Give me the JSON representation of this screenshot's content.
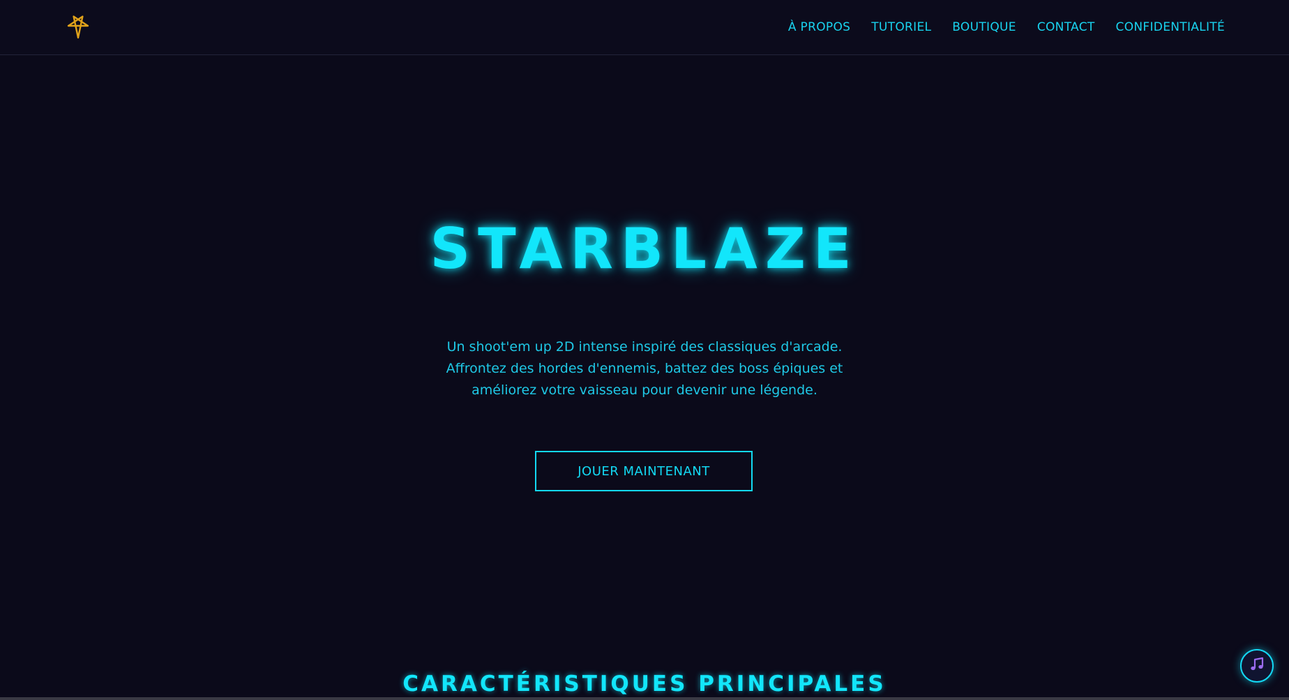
{
  "colors": {
    "background": "#0b0a1a",
    "accent": "#12e6fb",
    "logo": "#e0a21a",
    "music_icon": "#9b6cf0"
  },
  "header": {
    "logo_icon": "pentagram-star-icon",
    "nav": [
      {
        "label": "À PROPOS"
      },
      {
        "label": "TUTORIEL"
      },
      {
        "label": "BOUTIQUE"
      },
      {
        "label": "CONTACT"
      },
      {
        "label": "CONFIDENTIALITÉ"
      }
    ]
  },
  "hero": {
    "title": "STARBLAZE",
    "description": "Un shoot'em up 2D intense inspiré des classiques d'arcade. Affrontez des hordes d'ennemis, battez des boss épiques et améliorez votre vaisseau pour devenir une légende.",
    "cta_label": "JOUER MAINTENANT"
  },
  "features": {
    "title": "CARACTÉRISTIQUES PRINCIPALES"
  },
  "music_button": {
    "icon": "music-note-icon"
  }
}
